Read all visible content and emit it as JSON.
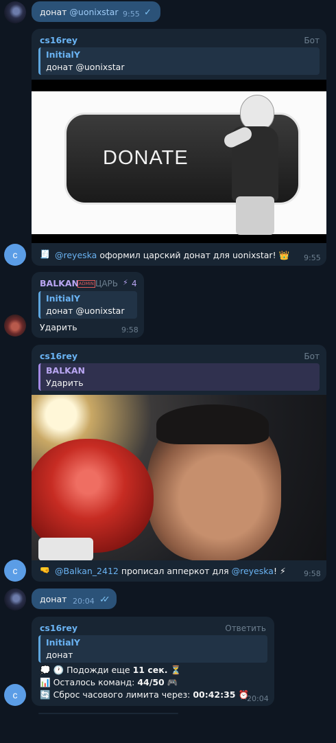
{
  "msg1": {
    "text": "донат ",
    "mention": "@uonixstar",
    "time": "9:55"
  },
  "msg2": {
    "sender": "cs16rey",
    "tag": "Бот",
    "reply_name": "InitialY",
    "reply_text": "донат @uonixstar",
    "banner_text": "DONATE",
    "mention": "@reyeska",
    "text": " оформил царский донат для uonixstar! ",
    "time": "9:55",
    "avatar": "c"
  },
  "msg3": {
    "sender": "BALKAN",
    "badge": "ADMIN",
    "role": "ЦАРЬ",
    "level": "4",
    "reply_name": "InitialY",
    "reply_text": "донат @uonixstar",
    "text": "Ударить",
    "time": "9:58"
  },
  "msg4": {
    "sender": "cs16rey",
    "tag": "Бот",
    "reply_name": "BALKAN",
    "reply_text": "Ударить",
    "mention1": "@Balkan_2412",
    "text": " прописал апперкот для ",
    "mention2": "@reyeska",
    "text_end": "! ",
    "time": "9:58",
    "avatar": "c"
  },
  "msg5": {
    "text": "донат",
    "time": "20:04"
  },
  "msg6": {
    "sender": "cs16rey",
    "tag": "Ответить",
    "reply_name": "InitialY",
    "reply_text": "донат",
    "line1_pre": "Подожди еще ",
    "line1_bold": "11 сек.",
    "line2_pre": "Осталось команд: ",
    "line2_bold": "44/50",
    "line3_pre": "Сброс часового лимита через: ",
    "line3_bold": "00:42:35",
    "time": "20:04",
    "avatar": "c"
  },
  "icons": [
    "check-icon",
    "double-check-icon",
    "crown-icon",
    "lightning-icon",
    "fist-icon",
    "hourglass-icon",
    "clock-icon",
    "alarm-icon",
    "gamepad-icon",
    "chart-icon",
    "refresh-icon"
  ]
}
